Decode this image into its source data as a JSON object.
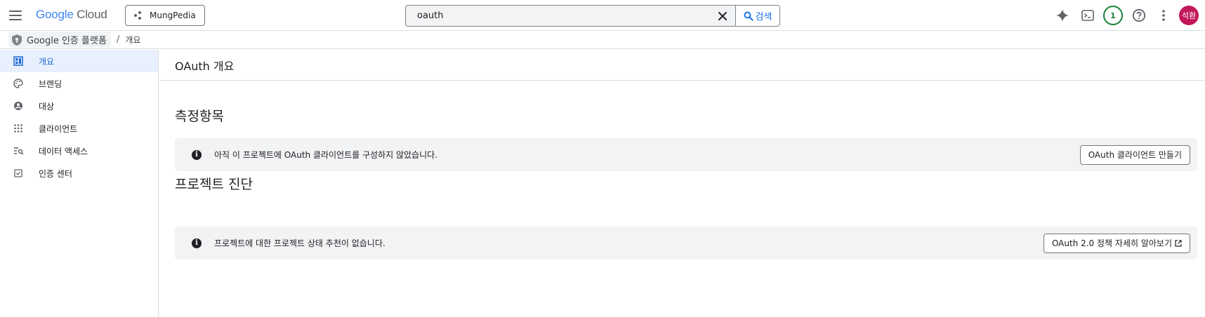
{
  "topbar": {
    "logo": {
      "google": "Google",
      "cloud": "Cloud"
    },
    "project": "MungPedia",
    "search": {
      "value": "oauth",
      "button_label": "검색"
    },
    "notification_count": "1",
    "avatar_initials": "석환",
    "icons": [
      "menu-icon",
      "project-dots-icon",
      "close-icon",
      "search-icon",
      "gemini-sparkle-icon",
      "terminal-icon",
      "help-icon",
      "more-vert-icon"
    ]
  },
  "breadcrumb": {
    "product": "Google 인증 플랫폼",
    "separator": "/",
    "current": "개요"
  },
  "sidebar": {
    "items": [
      {
        "label": "개요",
        "icon": "dashboard-icon",
        "active": true
      },
      {
        "label": "브랜딩",
        "icon": "palette-icon",
        "active": false
      },
      {
        "label": "대상",
        "icon": "account-circle-icon",
        "active": false
      },
      {
        "label": "클라이언트",
        "icon": "apps-grid-icon",
        "active": false
      },
      {
        "label": "데이터 액세스",
        "icon": "manage-search-icon",
        "active": false
      },
      {
        "label": "인증 센터",
        "icon": "verified-check-icon",
        "active": false
      }
    ]
  },
  "main": {
    "title": "OAuth 개요",
    "metrics": {
      "title": "측정항목",
      "message": "아직 이 프로젝트에 OAuth 클라이언트를 구성하지 않았습니다.",
      "button": "OAuth 클라이언트 만들기"
    },
    "diagnostics": {
      "title": "프로젝트 진단",
      "message": "프로젝트에 대한 프로젝트 상태 추천이 없습니다.",
      "button": "OAuth 2.0 정책 자세히 알아보기"
    }
  },
  "colors": {
    "accent": "#1a73e8",
    "active_nav_bg": "#e8f0fe",
    "card_bg": "#f1f3f4",
    "avatar_bg": "#c2185b",
    "notif_green": "#188038"
  }
}
